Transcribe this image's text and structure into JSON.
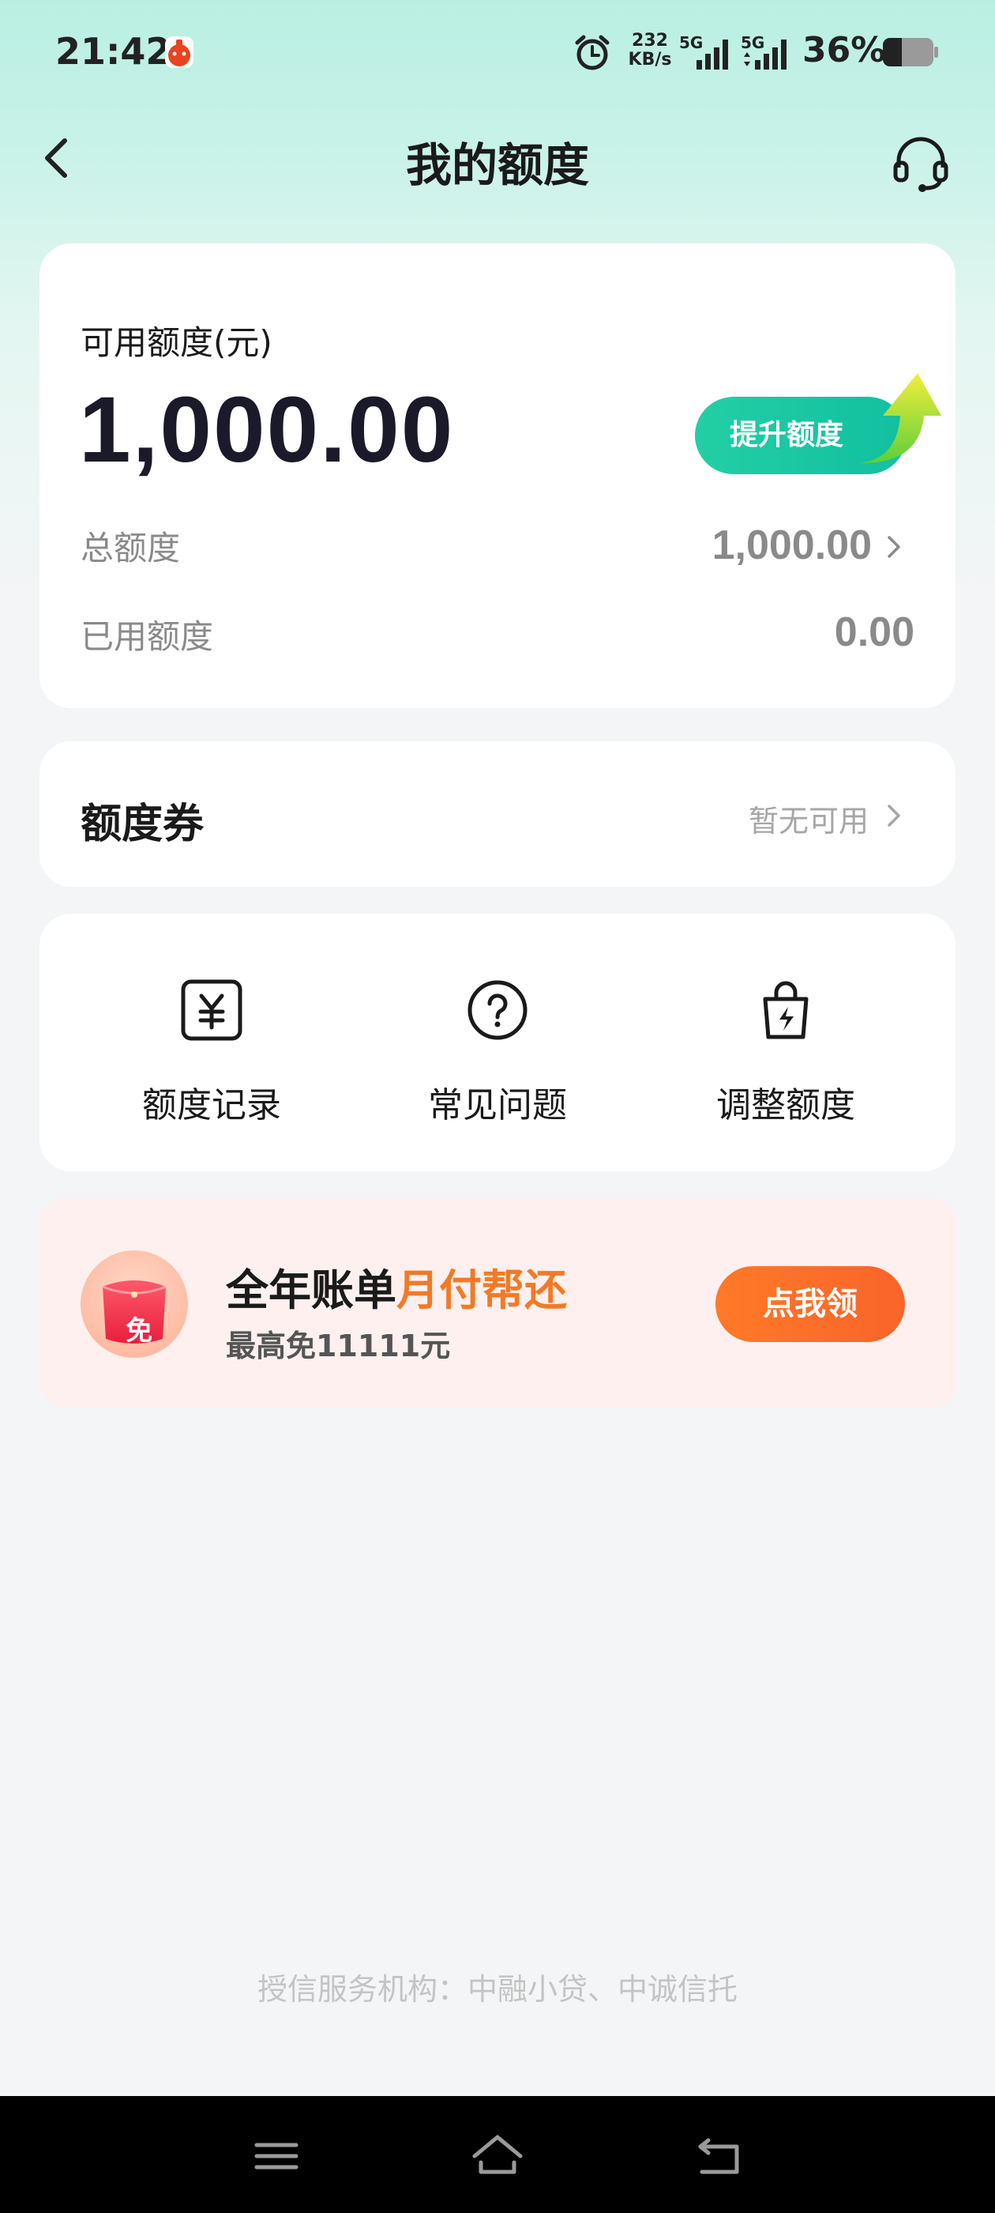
{
  "status_bar": {
    "time": "21:42",
    "net_speed_value": "232",
    "net_speed_unit": "KB/s",
    "signal_1_label": "5G",
    "signal_2_label": "5G",
    "battery_percent": "36%"
  },
  "header": {
    "title": "我的额度"
  },
  "quota": {
    "available_label": "可用额度(元)",
    "available_amount": "1,000.00",
    "raise_button_label": "提升额度",
    "total_label": "总额度",
    "total_value": "1,000.00",
    "used_label": "已用额度",
    "used_value": "0.00"
  },
  "coupon": {
    "title": "额度券",
    "status": "暂无可用"
  },
  "shortcuts": [
    {
      "label": "额度记录",
      "icon": "yen-record-icon"
    },
    {
      "label": "常见问题",
      "icon": "question-circle-icon"
    },
    {
      "label": "调整额度",
      "icon": "bag-lightning-icon"
    }
  ],
  "promo": {
    "badge_text": "免",
    "title_plain": "全年账单",
    "title_highlight": "月付帮还",
    "subtitle": "最高免11111元",
    "button_label": "点我领"
  },
  "footer": {
    "note": "授信服务机构：中融小贷、中诚信托"
  },
  "colors": {
    "accent_green": "#12bfa0",
    "promo_orange": "#f27a26",
    "promo_bg": "#fdf0ef"
  }
}
